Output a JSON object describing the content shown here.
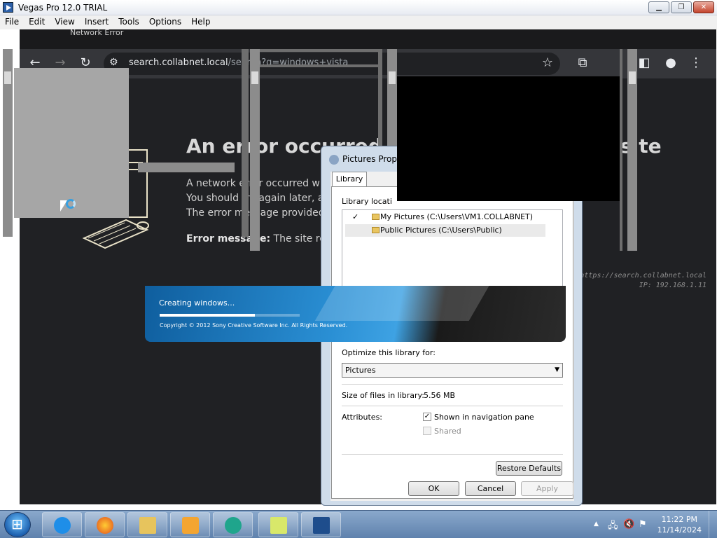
{
  "vegas": {
    "title": "Vegas Pro 12.0 TRIAL",
    "menu": [
      "File",
      "Edit",
      "View",
      "Insert",
      "Tools",
      "Options",
      "Help"
    ],
    "controls": {
      "minimize": "▁",
      "restore": "❐",
      "close": "✕"
    }
  },
  "browser": {
    "tab_title": "Network Error",
    "url_host": "search.collabnet.local",
    "url_path": "/search?q=windows+vista",
    "error_heading": "An error occurred",
    "error_heading_tail": "site",
    "lines": [
      "A network error occurred w",
      "You should try again later, a",
      "The error message provided"
    ],
    "error_message_label": "Error message:",
    "error_message_text": "The site rec",
    "info_url": "https://search.collabnet.local",
    "info_ip": "IP: 192.168.1.11"
  },
  "dialog": {
    "title": "Pictures Prop",
    "tab": "Library",
    "locations_label": "Library locati",
    "locations": [
      {
        "check": "✓",
        "text": "My Pictures (C:\\Users\\VM1.COLLABNET)"
      },
      {
        "check": "",
        "text": "Public Pictures (C:\\Users\\Public)"
      }
    ],
    "optimize_label": "Optimize this library for:",
    "optimize_value": "Pictures",
    "size_label": "Size of files in library:",
    "size_value": "5.56 MB",
    "attributes_label": "Attributes:",
    "attr_nav": {
      "label": "Shown in navigation pane",
      "checked": true,
      "mark": "✓"
    },
    "attr_shared": {
      "label": "Shared",
      "checked": false
    },
    "restore_defaults": "Restore Defaults",
    "ok": "OK",
    "cancel": "Cancel",
    "apply": "Apply"
  },
  "splash": {
    "status": "Creating windows...",
    "progress": 0.68,
    "copyright": "Copyright © 2012 Sony Creative Software Inc. All Rights Reserved."
  },
  "taskbar": {
    "clock_time": "11:22 PM",
    "clock_date": "11/14/2024",
    "apps": [
      "internet-explorer",
      "firefox",
      "file-explorer",
      "media-player",
      "app-teal",
      "sticky-notes",
      "vegas-pro"
    ],
    "tray": {
      "arrow": "▲",
      "network": "🖧",
      "volume": "🔇",
      "flag": "⚑"
    }
  }
}
